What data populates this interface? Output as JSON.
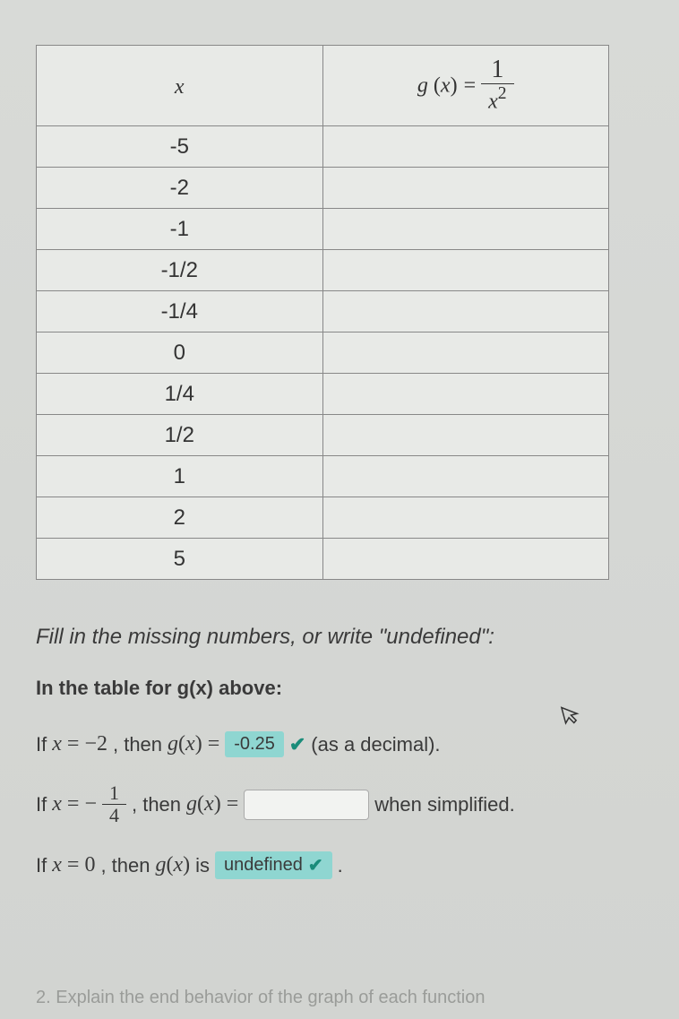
{
  "table": {
    "header_x": "x",
    "header_gx_left": "g",
    "header_gx_paren_x": "(x)",
    "header_eq": " = ",
    "frac_num": "1",
    "frac_den_var": "x",
    "frac_den_exp": "2",
    "rows": [
      "-5",
      "-2",
      "-1",
      "-1/2",
      "-1/4",
      "0",
      "1/4",
      "1/2",
      "1",
      "2",
      "5"
    ]
  },
  "instruction": "Fill in the missing numbers, or write \"undefined\":",
  "subhead": "In the table for g(x) above:",
  "q1": {
    "prefix": "If ",
    "var": "x",
    "eq": " = ",
    "val": "−2",
    "mid": ", then ",
    "gx": "g(x)",
    "eq2": " = ",
    "answer": "-0.25",
    "suffix": "(as a decimal)."
  },
  "q2": {
    "prefix": "If ",
    "var": "x",
    "eq": " = ",
    "neg": "−",
    "frac_num": "1",
    "frac_den": "4",
    "mid": ", then ",
    "gx": "g(x)",
    "eq2": " = ",
    "suffix": "when simplified."
  },
  "q3": {
    "prefix": "If ",
    "var": "x",
    "eq": " = ",
    "val": "0",
    "mid": ", then ",
    "gx": "g(x)",
    "is": " is ",
    "answer": "undefined",
    "period": "."
  },
  "bottom": "2. Explain the end behavior of the graph of each function"
}
